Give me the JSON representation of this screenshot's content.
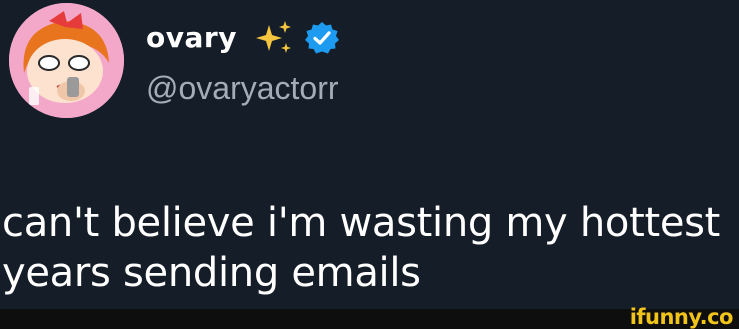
{
  "tweet": {
    "display_name": "ovary",
    "handle": "@ovaryactorr",
    "text": "can't believe i'm wasting my hottest years sending emails",
    "name_emoji": "sparkles-icon",
    "verified": true
  },
  "watermark": {
    "text": "ifunny.co"
  },
  "colors": {
    "background": "#151e28",
    "text": "#ffffff",
    "handle": "#a4adb7",
    "verified_badge": "#1d9bf0",
    "sparkles": "#f6c540",
    "watermark": "#f0c419"
  }
}
